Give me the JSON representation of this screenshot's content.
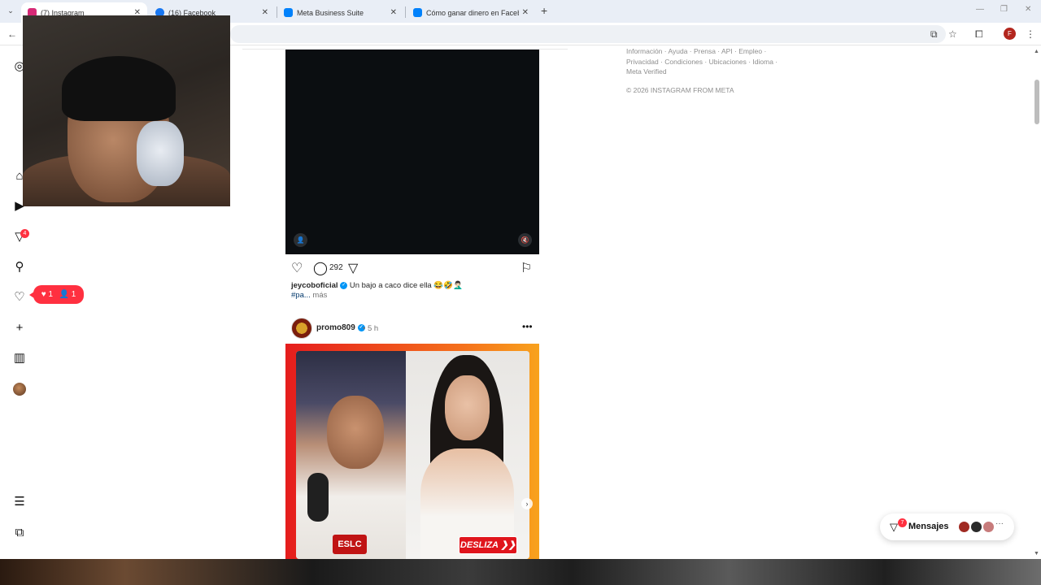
{
  "browser": {
    "tabs": [
      {
        "title": "(7) Instagram",
        "favicon_color": "#d62976"
      },
      {
        "title": "(16) Facebook",
        "favicon_color": "#1877f2"
      },
      {
        "title": "Meta Business Suite",
        "favicon_color": "#0081fb"
      },
      {
        "title": "Cómo ganar dinero en Faceboo",
        "favicon_color": "#0081fb"
      }
    ],
    "close_glyph": "✕",
    "new_tab_glyph": "+",
    "profile_initial": "F"
  },
  "nav": {
    "explore_badge": "4",
    "notif_likes": "1",
    "notif_follows": "1"
  },
  "post1": {
    "comment_count": "292",
    "username": "jeycoboficial",
    "caption": "Un bajo a caco dice ella 😂🤣🤦🏻‍♂️",
    "hashtag": "#pa...",
    "more": "más"
  },
  "post2": {
    "username": "promo809",
    "time": "• 5 h",
    "image_logo": "ESLC",
    "image_cta": "DESLIZA"
  },
  "footer": {
    "links_row1": "Información · Ayuda · Prensa · API · Empleo ·",
    "links_row2": "Privacidad · Condiciones · Ubicaciones · Idioma ·",
    "links_row3": "Meta Verified",
    "copyright": "© 2026 INSTAGRAM FROM META"
  },
  "messages": {
    "label": "Mensajes",
    "badge": "7"
  }
}
